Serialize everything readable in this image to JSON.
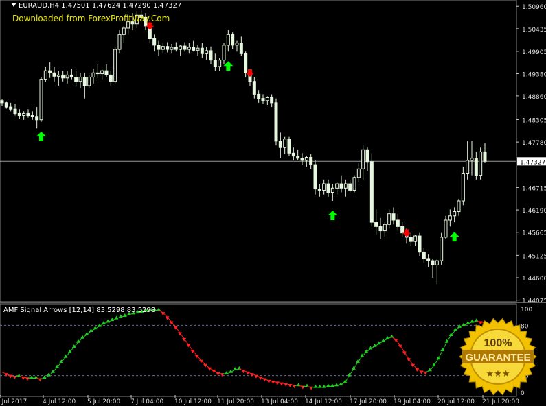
{
  "header": {
    "symbol": "EURAUD,H4",
    "ohlc": "1.47501 1.47624 1.47290 1.47327",
    "watermark": "Downloaded from ForexProfitWay.Com"
  },
  "indicator": {
    "title": "AMF Signal Arrows [12,14] 83.5298 83.5298"
  },
  "badge": {
    "line1": "100%",
    "line2": "GUARANTEE",
    "stars": "★★★"
  },
  "colors": {
    "bull": "#00ff00",
    "bear": "#ff0000",
    "candle_body": "#e8f8e0",
    "grid": "#555555",
    "line_down": "#ff2020",
    "line_up": "#22cc22",
    "badge_gold": "#f2c200"
  },
  "chart_data": [
    {
      "type": "candlestick",
      "title": "EURAUD,H4",
      "current_price": 1.47327,
      "ylim": [
        1.4407,
        1.5106
      ],
      "y_ticks": [
        "1.50960",
        "1.50435",
        "1.49905",
        "1.49380",
        "1.48860",
        "1.48305",
        "1.47780",
        "1.47327",
        "1.46715",
        "1.46190",
        "1.45665",
        "1.45125",
        "1.44600",
        "1.44075"
      ],
      "x_ticks": [
        "3 Jul 2017",
        "4 Jul 12:00",
        "5 Jul 20:00",
        "7 Jul 04:00",
        "10 Jul 12:00",
        "11 Jul 20:00",
        "13 Jul 04:00",
        "14 Jul 12:00",
        "17 Jul 20:00",
        "19 Jul 04:00",
        "20 Jul 12:00",
        "21 Jul 20:00"
      ],
      "candles": [
        [
          1.4875,
          1.4878,
          1.4862,
          1.487
        ],
        [
          1.487,
          1.4872,
          1.4856,
          1.486
        ],
        [
          1.486,
          1.487,
          1.485,
          1.4855
        ],
        [
          1.4855,
          1.4868,
          1.484,
          1.4845
        ],
        [
          1.4845,
          1.4855,
          1.4832,
          1.484
        ],
        [
          1.484,
          1.485,
          1.483,
          1.4845
        ],
        [
          1.4845,
          1.4855,
          1.4835,
          1.484
        ],
        [
          1.484,
          1.485,
          1.483,
          1.4838
        ],
        [
          1.4838,
          1.486,
          1.481,
          1.483
        ],
        [
          1.483,
          1.493,
          1.4825,
          1.4925
        ],
        [
          1.4925,
          1.4955,
          1.4918,
          1.4945
        ],
        [
          1.4945,
          1.4965,
          1.4928,
          1.494
        ],
        [
          1.494,
          1.4955,
          1.492,
          1.4932
        ],
        [
          1.4932,
          1.4945,
          1.491,
          1.4935
        ],
        [
          1.4935,
          1.4945,
          1.492,
          1.4928
        ],
        [
          1.4928,
          1.4945,
          1.4915,
          1.4935
        ],
        [
          1.4935,
          1.495,
          1.4925,
          1.493
        ],
        [
          1.493,
          1.4945,
          1.491,
          1.492
        ],
        [
          1.492,
          1.494,
          1.4905,
          1.493
        ],
        [
          1.493,
          1.494,
          1.488,
          1.491
        ],
        [
          1.491,
          1.4935,
          1.4905,
          1.493
        ],
        [
          1.493,
          1.495,
          1.4915,
          1.494
        ],
        [
          1.494,
          1.496,
          1.4928,
          1.4938
        ],
        [
          1.4938,
          1.495,
          1.4925,
          1.4945
        ],
        [
          1.4945,
          1.496,
          1.493,
          1.4935
        ],
        [
          1.4935,
          1.4945,
          1.491,
          1.492
        ],
        [
          1.492,
          1.5,
          1.4915,
          1.4995
        ],
        [
          1.4995,
          1.504,
          1.4985,
          1.503
        ],
        [
          1.503,
          1.505,
          1.501,
          1.5045
        ],
        [
          1.5045,
          1.507,
          1.503,
          1.506
        ],
        [
          1.506,
          1.508,
          1.504,
          1.5055
        ],
        [
          1.5055,
          1.5085,
          1.5045,
          1.5075
        ],
        [
          1.5075,
          1.509,
          1.506,
          1.507
        ],
        [
          1.507,
          1.508,
          1.504,
          1.505
        ],
        [
          1.505,
          1.506,
          1.501,
          1.502
        ],
        [
          1.502,
          1.503,
          1.499,
          1.5005
        ],
        [
          1.5005,
          1.5015,
          1.498,
          1.4995
        ],
        [
          1.4995,
          1.501,
          1.4985,
          1.5002
        ],
        [
          1.5002,
          1.5012,
          1.4988,
          1.4995
        ],
        [
          1.4995,
          1.5008,
          1.4985,
          1.5
        ],
        [
          1.5,
          1.5012,
          1.499,
          1.4995
        ],
        [
          1.4995,
          1.5005,
          1.498,
          1.5003
        ],
        [
          1.5003,
          1.5012,
          1.499,
          1.4995
        ],
        [
          1.4995,
          1.501,
          1.4985,
          1.5
        ],
        [
          1.5,
          1.5015,
          1.499,
          1.4993
        ],
        [
          1.4993,
          1.5005,
          1.498,
          1.4998
        ],
        [
          1.4998,
          1.501,
          1.4975,
          1.4985
        ],
        [
          1.4985,
          1.5,
          1.497,
          1.4992
        ],
        [
          1.4992,
          1.5002,
          1.496,
          1.497
        ],
        [
          1.497,
          1.4985,
          1.4945,
          1.4955
        ],
        [
          1.4955,
          1.4975,
          1.4945,
          1.497
        ],
        [
          1.497,
          1.501,
          1.496,
          1.5005
        ],
        [
          1.5005,
          1.504,
          1.499,
          1.503
        ],
        [
          1.503,
          1.5035,
          1.4995,
          1.5005
        ],
        [
          1.5005,
          1.5015,
          1.499,
          1.501
        ],
        [
          1.501,
          1.5025,
          1.498,
          1.4985
        ],
        [
          1.4985,
          1.499,
          1.493,
          1.494
        ],
        [
          1.494,
          1.495,
          1.491,
          1.492
        ],
        [
          1.492,
          1.493,
          1.488,
          1.489
        ],
        [
          1.489,
          1.49,
          1.487,
          1.488
        ],
        [
          1.488,
          1.489,
          1.4868,
          1.4875
        ],
        [
          1.4875,
          1.4885,
          1.4865,
          1.4882
        ],
        [
          1.4882,
          1.489,
          1.486,
          1.487
        ],
        [
          1.487,
          1.488,
          1.477,
          1.478
        ],
        [
          1.478,
          1.48,
          1.474,
          1.4765
        ],
        [
          1.4765,
          1.479,
          1.475,
          1.4785
        ],
        [
          1.4785,
          1.479,
          1.4745,
          1.4752
        ],
        [
          1.4752,
          1.4765,
          1.4735,
          1.4745
        ],
        [
          1.4745,
          1.476,
          1.4735,
          1.474
        ],
        [
          1.474,
          1.4752,
          1.4725,
          1.4735
        ],
        [
          1.4735,
          1.4745,
          1.472,
          1.4742
        ],
        [
          1.4742,
          1.475,
          1.4715,
          1.4725
        ],
        [
          1.4725,
          1.4735,
          1.4655,
          1.4668
        ],
        [
          1.4668,
          1.468,
          1.465,
          1.4665
        ],
        [
          1.4665,
          1.469,
          1.4655,
          1.468
        ],
        [
          1.468,
          1.469,
          1.465,
          1.466
        ],
        [
          1.466,
          1.468,
          1.464,
          1.467
        ],
        [
          1.467,
          1.4685,
          1.4655,
          1.468
        ],
        [
          1.468,
          1.47,
          1.466,
          1.467
        ],
        [
          1.467,
          1.469,
          1.465,
          1.468
        ],
        [
          1.468,
          1.469,
          1.466,
          1.4665
        ],
        [
          1.4665,
          1.47,
          1.466,
          1.4695
        ],
        [
          1.4695,
          1.473,
          1.4685,
          1.4715
        ],
        [
          1.4715,
          1.477,
          1.469,
          1.476
        ],
        [
          1.476,
          1.4765,
          1.471,
          1.4732
        ],
        [
          1.4732,
          1.4752,
          1.458,
          1.459
        ],
        [
          1.459,
          1.462,
          1.456,
          1.458
        ],
        [
          1.458,
          1.46,
          1.455,
          1.457
        ],
        [
          1.457,
          1.459,
          1.4555,
          1.4585
        ],
        [
          1.4585,
          1.462,
          1.4575,
          1.461
        ],
        [
          1.461,
          1.4625,
          1.4585,
          1.4595
        ],
        [
          1.4595,
          1.461,
          1.457,
          1.458
        ],
        [
          1.458,
          1.459,
          1.4555,
          1.4565
        ],
        [
          1.4565,
          1.4575,
          1.454,
          1.4555
        ],
        [
          1.4555,
          1.4565,
          1.4535,
          1.4545
        ],
        [
          1.4545,
          1.456,
          1.4535,
          1.4558
        ],
        [
          1.4558,
          1.4565,
          1.451,
          1.452
        ],
        [
          1.452,
          1.453,
          1.4495,
          1.4505
        ],
        [
          1.4505,
          1.4515,
          1.4485,
          1.45
        ],
        [
          1.45,
          1.4505,
          1.446,
          1.449
        ],
        [
          1.449,
          1.4505,
          1.4445,
          1.45
        ],
        [
          1.45,
          1.4565,
          1.449,
          1.4555
        ],
        [
          1.4555,
          1.4605,
          1.455,
          1.4595
        ],
        [
          1.4595,
          1.462,
          1.458,
          1.4605
        ],
        [
          1.4605,
          1.4625,
          1.459,
          1.4615
        ],
        [
          1.4615,
          1.4645,
          1.4605,
          1.464
        ],
        [
          1.464,
          1.472,
          1.463,
          1.4705
        ],
        [
          1.4705,
          1.478,
          1.469,
          1.4735
        ],
        [
          1.4735,
          1.478,
          1.47,
          1.474
        ],
        [
          1.474,
          1.4755,
          1.469,
          1.47
        ],
        [
          1.47,
          1.4765,
          1.469,
          1.4755
        ],
        [
          1.4755,
          1.4775,
          1.473,
          1.4733
        ]
      ],
      "signals": [
        {
          "index": 9,
          "type": "buy"
        },
        {
          "index": 34,
          "type": "sell"
        },
        {
          "index": 52,
          "type": "buy"
        },
        {
          "index": 57,
          "type": "sell"
        },
        {
          "index": 76,
          "type": "buy"
        },
        {
          "index": 93,
          "type": "sell"
        },
        {
          "index": 104,
          "type": "buy"
        }
      ]
    },
    {
      "type": "line",
      "title": "AMF Signal Arrows [12,14] 83.5298 83.5298",
      "ylim": [
        0,
        100
      ],
      "y_ticks": [
        "100",
        "80",
        "20",
        "0"
      ],
      "levels": [
        80,
        20
      ],
      "series": [
        {
          "values": [
            24,
            22,
            20,
            19,
            19,
            18,
            17,
            17,
            17,
            16,
            17,
            20,
            24,
            30,
            36,
            42,
            48,
            54,
            60,
            65,
            69,
            73,
            76,
            79,
            82,
            84,
            86,
            88,
            90,
            91,
            93,
            94,
            95,
            96,
            97,
            98,
            98,
            98,
            95,
            90,
            84,
            78,
            71,
            64,
            57,
            50,
            44,
            38,
            33,
            29,
            26,
            23,
            22,
            22,
            24,
            27,
            28,
            26,
            24,
            22,
            20,
            18,
            16,
            14,
            13,
            12,
            11,
            10,
            9,
            8,
            8,
            7,
            7,
            6,
            6,
            6,
            6,
            7,
            7,
            8,
            9,
            12,
            20,
            28,
            36,
            43,
            48,
            52,
            55,
            58,
            61,
            64,
            66,
            63,
            56,
            48,
            40,
            33,
            28,
            25,
            24,
            26,
            32,
            40,
            50,
            60,
            68,
            74,
            78,
            80,
            82,
            84,
            85,
            84,
            83
          ],
          "segments": [
            "down 0-11",
            "up 11-37",
            "down 37-54",
            "up 54-56",
            "down 56-76",
            "up 76-93",
            "down 93-101",
            "up 101-113"
          ]
        }
      ]
    }
  ]
}
